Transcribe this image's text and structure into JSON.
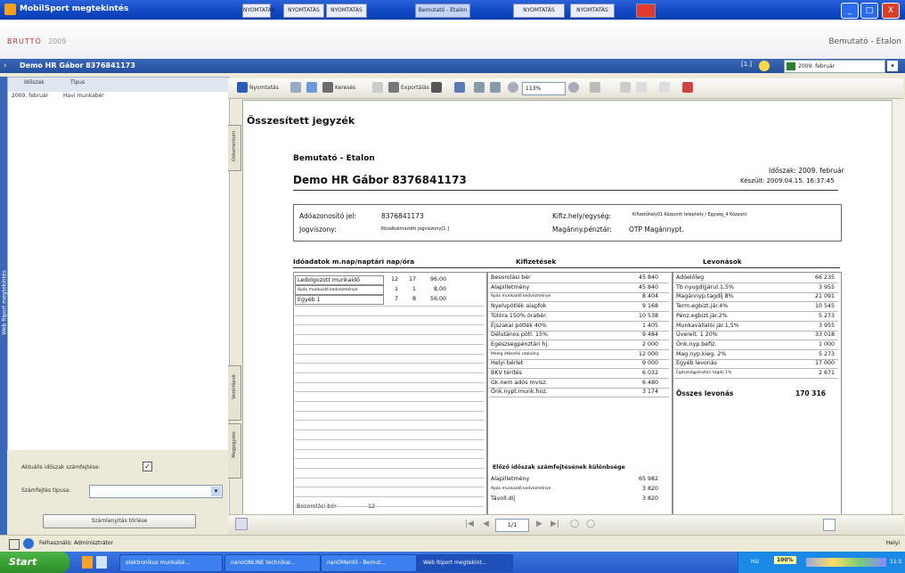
{
  "window": {
    "title": "MobilSport megtekintés",
    "tabs": [
      "NYOMTATÁS",
      "NYOMTATÁS",
      "NYOMTATÁS",
      "Bemutató - Etalon",
      "NYOMTATÁS",
      "NYOMTATÁS",
      ""
    ],
    "buttons": [
      "_",
      "□",
      "X"
    ]
  },
  "app": {
    "brand": "BRUTTÓ",
    "brand_year": "2009",
    "header_right": "Bemutató - Etalon"
  },
  "bluebar": {
    "employee": "Demo HR Gábor 8376841173",
    "page": "[1.]",
    "period": "2009. február"
  },
  "left_panel": {
    "headers": [
      "Időszak",
      "Típus"
    ],
    "row": [
      "2009. február",
      "Havi munkabér"
    ],
    "vertical_label": "Web Riport megtekintés",
    "current_period_label": "Aktuális időszak számfejtése:",
    "checkbox_checked": "✓",
    "type_label": "Számfejtés típusa:",
    "reset_button": "Számlanyitás törlése"
  },
  "side_tabs": [
    "Dokumentum",
    "Vezérlőpult",
    "Megjegyzés"
  ],
  "toolbar": {
    "print_label": "Nyomtatás",
    "search_label": "Keresés",
    "export_label": "Exportálás",
    "zoom": "113%"
  },
  "report": {
    "title": "Összesített jegyzék",
    "company": "Bemutató - Etalon",
    "employee": "Demo HR Gábor  8376841173",
    "period": "Időszak: 2009. február",
    "made": "Készült: 2009.04.15. 16:37:45",
    "tax_id_label": "Adóazonosító jel:",
    "tax_id": "8376841173",
    "relation_label": "Jogviszony:",
    "relation": "Közalkalmazotti jogviszony[1.]",
    "site_label": "Kifiz.hely/egység:",
    "site": "Kifizetőhely01 Központi telephely / Egység_4 Központ",
    "fund_label": "Magánny.pénztár:",
    "fund": "OTP Magánnypt.",
    "col1_title": "Időadatok m.nap/naptári nap/óra",
    "col2_title": "Kifizetések",
    "col3_title": "Levonások",
    "time_rows": [
      [
        "Ledolgozott munkaidő",
        "12",
        "17",
        "96,00"
      ],
      [
        "Apás munkaidő kedvezménye",
        "1",
        "1",
        "8,00"
      ],
      [
        "Egyéb 1",
        "7",
        "8",
        "56,00"
      ]
    ],
    "payments": [
      [
        "Besorolási bér",
        "45 840"
      ],
      [
        "Alapilletmény",
        "45 840"
      ],
      [
        "Apás munkaidő kedvezménye",
        "8 404"
      ],
      [
        "Nyelvpótlék alapfok",
        "9 168"
      ],
      [
        "Túlóra 150% órabér.",
        "10 538"
      ],
      [
        "Éjszakai pótlék 40%",
        "1 405"
      ],
      [
        "Délutános pótl. 15%",
        "9 484"
      ],
      [
        "Egészségpénztári hj.",
        "2 000"
      ],
      [
        "Meleg étkezési utalvány",
        "12 000"
      ],
      [
        "Helyi bérlet",
        "9 000"
      ],
      [
        "BKV térítés",
        "6 032"
      ],
      [
        "Gk.nem adós mvisz.",
        "6 480"
      ],
      [
        "Önk.nypt.munk.hoz.",
        "3 174"
      ]
    ],
    "deductions": [
      [
        "Adóelőleg",
        "66 235"
      ],
      [
        "Tb nyugdíjjárul.1,5%",
        "3 955"
      ],
      [
        "Magánnyp.tagdíj 8%",
        "21 091"
      ],
      [
        "Term.egbizt.jár.4%",
        "10 545"
      ],
      [
        "Pénz.egbizt.jár.2%",
        "5 273"
      ],
      [
        "Munkavállalói jár.1,5%",
        "3 955"
      ],
      [
        "Üvereit. 1 20%",
        "33 018"
      ],
      [
        "Önk.nyp.befiz.",
        "1 000"
      ],
      [
        "Mag.nyp.kieg. 2%",
        "5 273"
      ],
      [
        "Egyéb levonás",
        "17 000"
      ],
      [
        "Egészségpénztári tagdíj 1%",
        "2 671"
      ]
    ],
    "total_deductions_label": "Összes levonás",
    "total_deductions": "170 316",
    "prior_title": "Előző időszak számfejtésének különbsége",
    "prior_rows": [
      [
        "Alapilletmény",
        "65 982"
      ],
      [
        "Apás munkaidő kedvezménye",
        "3 820"
      ],
      [
        "Távoll.díj",
        "3 820"
      ]
    ],
    "left_bottom": [
      "Besorolási bér",
      "12"
    ]
  },
  "navbar": {
    "page": "1/1"
  },
  "statusbar": {
    "user": "Felhasználó: Adminisztrátor",
    "right": "Helyi"
  },
  "taskbar": {
    "start": "Start",
    "items": [
      "elektronikus munkabé...",
      "nanoONLINE technikai...",
      "nanOMentő - Bemut...",
      "Web Riport megtekint..."
    ],
    "tray": [
      "HU",
      "100%",
      "11:5"
    ]
  }
}
